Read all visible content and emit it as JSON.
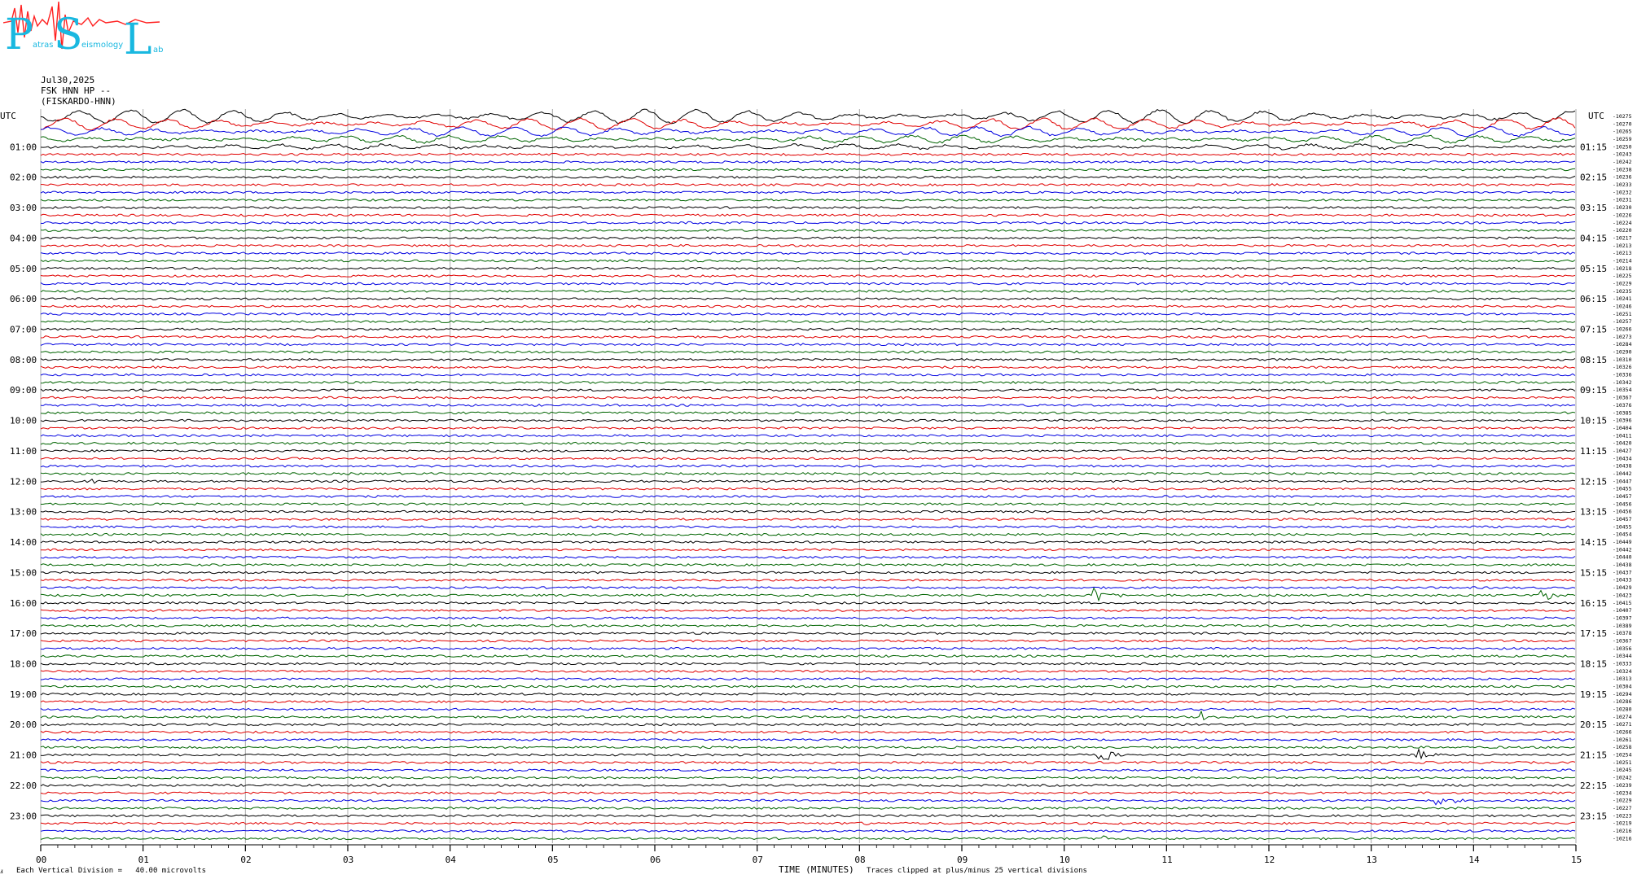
{
  "logo": {
    "letters": [
      "P",
      "S",
      "L"
    ],
    "words": [
      "atras",
      "eismology",
      "ab"
    ],
    "text_color": "#19b8e0",
    "trace_color": "#ff2020"
  },
  "header": {
    "date": "Jul30,2025",
    "station": "FSK HNN HP --",
    "station_name": "(FISKARDO-HNN)"
  },
  "footer": {
    "corner_mark": "ⅎ",
    "vertical_division": "Each Vertical Division =   40.00 microvolts",
    "clip_note": "Traces clipped at plus/minus 25 vertical divisions"
  },
  "chart_data": {
    "type": "line",
    "title": "",
    "xlabel": "TIME (MINUTES)",
    "xlim": [
      0,
      15
    ],
    "x_ticks": [
      "00",
      "01",
      "02",
      "03",
      "04",
      "05",
      "06",
      "07",
      "08",
      "09",
      "10",
      "11",
      "12",
      "13",
      "14",
      "15"
    ],
    "left_axis_label": "UTC",
    "right_axis_label": "UTC",
    "left_hour_labels": [
      "01:00",
      "02:00",
      "03:00",
      "04:00",
      "05:00",
      "06:00",
      "07:00",
      "08:00",
      "09:00",
      "10:00",
      "11:00",
      "12:00",
      "13:00",
      "14:00",
      "15:00",
      "16:00",
      "17:00",
      "18:00",
      "19:00",
      "20:00",
      "21:00",
      "22:00",
      "23:00"
    ],
    "right_hour_labels": [
      "01:15",
      "02:15",
      "03:15",
      "04:15",
      "05:15",
      "06:15",
      "07:15",
      "08:15",
      "09:15",
      "10:15",
      "11:15",
      "12:15",
      "13:15",
      "14:15",
      "15:15",
      "16:15",
      "17:15",
      "18:15",
      "19:15",
      "20:15",
      "21:15",
      "22:15",
      "23:15"
    ],
    "trace_count": 96,
    "trace_colors": [
      "#000000",
      "#e00000",
      "#0000e0",
      "#006400"
    ],
    "trace_offsets": [
      -10275,
      -10270,
      -10265,
      -10259,
      -10250,
      -10243,
      -10242,
      -10238,
      -10236,
      -10233,
      -10232,
      -10231,
      -10230,
      -10226,
      -10224,
      -10220,
      -10217,
      -10213,
      -10213,
      -10214,
      -10218,
      -10225,
      -10229,
      -10235,
      -10241,
      -10246,
      -10251,
      -10257,
      -10266,
      -10273,
      -10284,
      -10290,
      -10310,
      -10326,
      -10336,
      -10342,
      -10354,
      -10367,
      -10376,
      -10385,
      -10396,
      -10404,
      -10411,
      -10420,
      -10427,
      -10434,
      -10438,
      -10442,
      -10447,
      -10455,
      -10457,
      -10456,
      -10456,
      -10457,
      -10455,
      -10454,
      -10449,
      -10442,
      -10440,
      -10438,
      -10437,
      -10433,
      -10429,
      -10423,
      -10415,
      -10407,
      -10397,
      -10389,
      -10378,
      -10367,
      -10356,
      -10344,
      -10333,
      -10324,
      -10313,
      -10304,
      -10294,
      -10286,
      -10280,
      -10274,
      -10271,
      -10266,
      -10261,
      -10258,
      -10254,
      -10251,
      -10245,
      -10242,
      -10239,
      -10234,
      -10229,
      -10227,
      -10223,
      -10219,
      -10216,
      -10216
    ],
    "events": [
      {
        "trace": 78,
        "minute": 1.55,
        "amplitude": 4,
        "duration": 0.1
      },
      {
        "trace": 84,
        "minute": 10.35,
        "amplitude": 12,
        "duration": 0.25
      },
      {
        "trace": 84,
        "minute": 13.45,
        "amplitude": 10,
        "duration": 0.25
      },
      {
        "trace": 79,
        "minute": 11.35,
        "amplitude": 6,
        "duration": 0.2
      },
      {
        "trace": 63,
        "minute": 10.3,
        "amplitude": 12,
        "duration": 0.3
      },
      {
        "trace": 63,
        "minute": 14.65,
        "amplitude": 9,
        "duration": 0.2
      },
      {
        "trace": 90,
        "minute": 13.65,
        "amplitude": 5,
        "duration": 0.3
      },
      {
        "trace": 93,
        "minute": 8.0,
        "amplitude": 4,
        "duration": 0.1
      },
      {
        "trace": 95,
        "minute": 10.35,
        "amplitude": 8,
        "duration": 0.1
      },
      {
        "trace": 14,
        "minute": 10.7,
        "amplitude": 4,
        "duration": 0.1
      },
      {
        "trace": 14,
        "minute": 6.3,
        "amplitude": 3,
        "duration": 0.2
      },
      {
        "trace": 48,
        "minute": 0.5,
        "amplitude": 4,
        "duration": 0.2
      }
    ]
  }
}
